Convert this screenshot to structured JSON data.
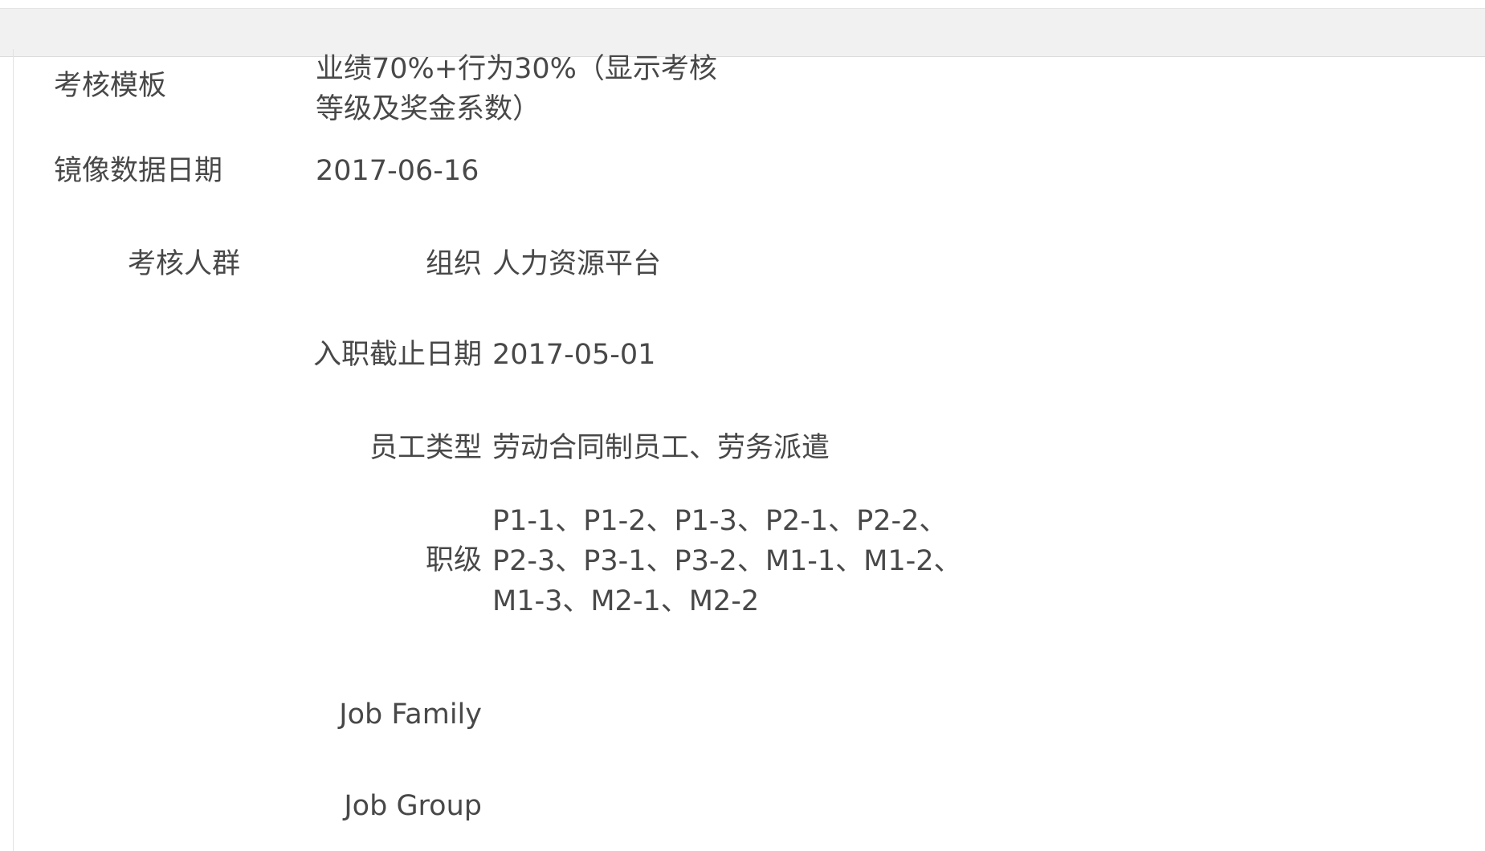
{
  "fields": {
    "template": {
      "label": "考核模板",
      "value_lines": [
        "业绩70%+行为30%（显示考核",
        "等级及奖金系数）"
      ]
    },
    "snapshot_date": {
      "label": "镜像数据日期",
      "value": "2017-06-16"
    }
  },
  "population": {
    "label": "考核人群",
    "rows": [
      {
        "label": "组织",
        "value_lines": [
          "人力资源平台"
        ]
      },
      {
        "label": "入职截止日期",
        "value_lines": [
          "2017-05-01"
        ]
      },
      {
        "label": "员工类型",
        "value_lines": [
          "劳动合同制员工、劳务派遣"
        ]
      },
      {
        "label": "职级",
        "value_lines": [
          "P1-1、P1-2、P1-3、P2-1、P2-2、",
          "P2-3、P3-1、P3-2、M1-1、M1-2、",
          "M1-3、M2-1、M2-2"
        ]
      },
      {
        "label": "Job Family",
        "value_lines": []
      },
      {
        "label": "Job Group",
        "value_lines": []
      }
    ]
  }
}
